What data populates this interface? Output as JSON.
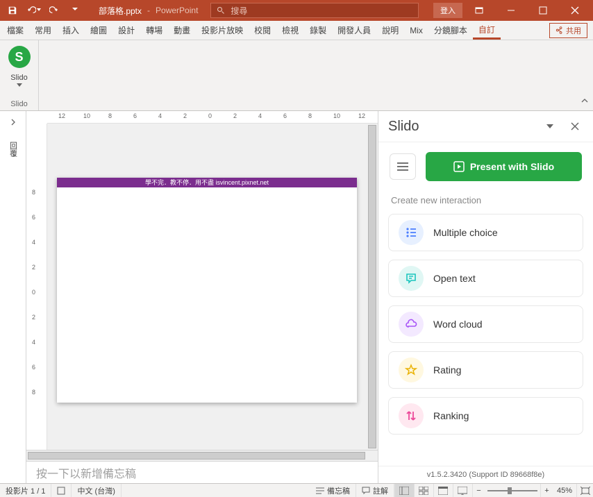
{
  "title_bar": {
    "doc_title": "部落格.pptx",
    "app_name": "PowerPoint",
    "search_placeholder": "搜尋",
    "login": "登入"
  },
  "ribbon": {
    "tabs": [
      "檔案",
      "常用",
      "插入",
      "繪圖",
      "設計",
      "轉場",
      "動畫",
      "投影片放映",
      "校閱",
      "檢視",
      "錄製",
      "開發人員",
      "說明",
      "Mix",
      "分鏡腳本",
      "自訂"
    ],
    "active_tab_index": 15,
    "share": "共用",
    "slido_btn": "Slido",
    "slido_group": "Slido"
  },
  "outline": {
    "label": "回覆"
  },
  "ruler_ticks": [
    "12",
    "10",
    "8",
    "6",
    "4",
    "2",
    "0",
    "2",
    "4",
    "6",
    "8",
    "10",
    "12"
  ],
  "ruler_v_ticks": [
    "8",
    "6",
    "4",
    "2",
    "0",
    "2",
    "4",
    "6",
    "8"
  ],
  "slide": {
    "header": "學不完．教不停．用不盡 isvincent.pixnet.net"
  },
  "notes": {
    "placeholder": "按一下以新增備忘稿"
  },
  "slido_panel": {
    "title": "Slido",
    "present": "Present with Slido",
    "create_label": "Create new interaction",
    "interactions": [
      {
        "label": "Multiple choice"
      },
      {
        "label": "Open text"
      },
      {
        "label": "Word cloud"
      },
      {
        "label": "Rating"
      },
      {
        "label": "Ranking"
      }
    ],
    "footer": "v1.5.2.3420 (Support ID 89668f8e)"
  },
  "status": {
    "slide": "投影片 1 / 1",
    "lang": "中文 (台灣)",
    "notes": "備忘稿",
    "comments": "註解",
    "zoom": "45%"
  }
}
